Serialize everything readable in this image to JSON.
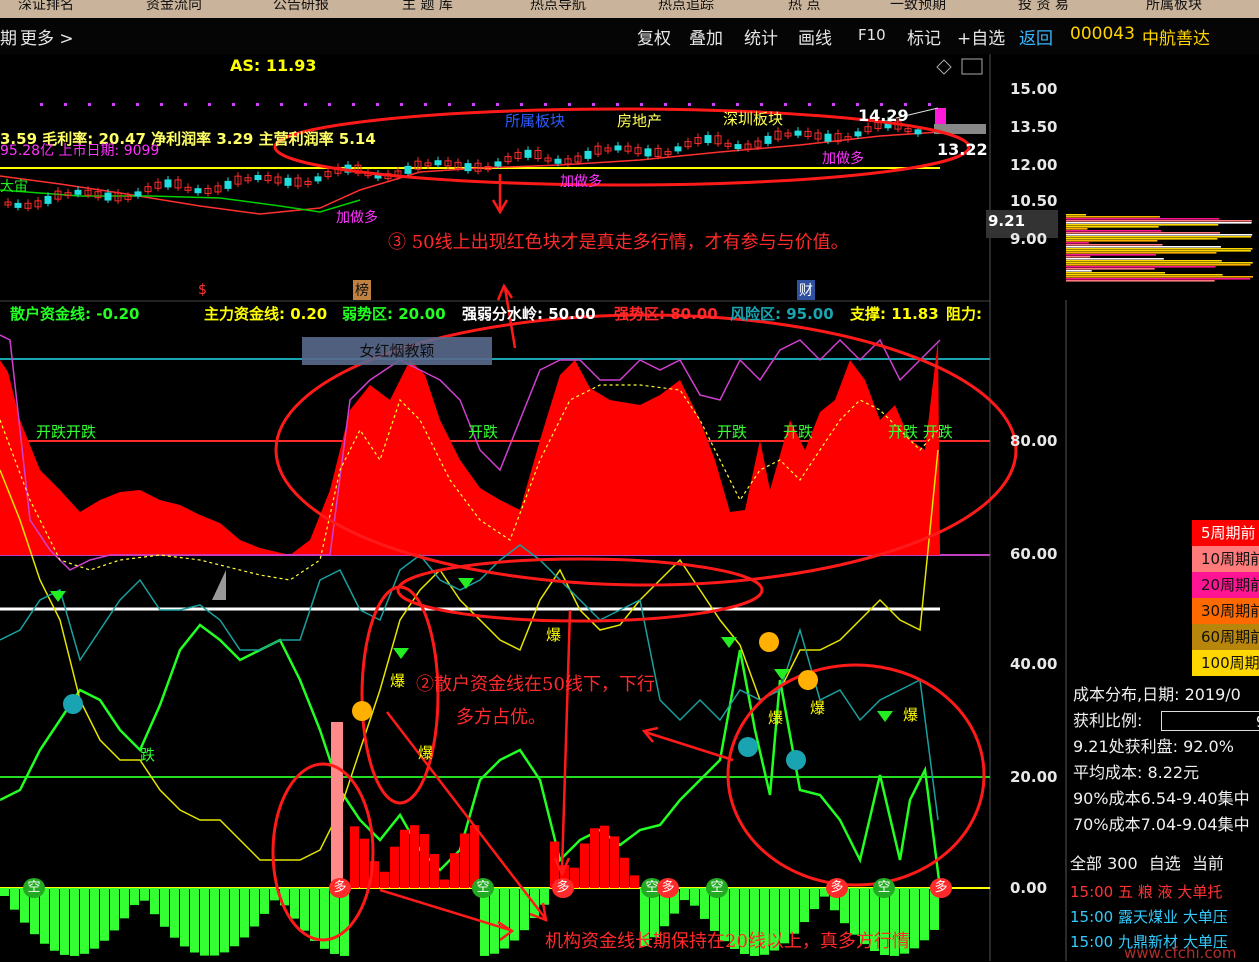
{
  "topnav": [
    "深证排名",
    "资金流向",
    "公告研报",
    "主 题 库",
    "热点导航",
    "热点追踪",
    "热  点",
    "一致预期",
    "投 资 易",
    "所属板块"
  ],
  "toolbar": {
    "left_text": "期",
    "more": "更多 >",
    "buttons": [
      "复权",
      "叠加",
      "统计",
      "画线",
      "F10",
      "标记",
      "+自选"
    ],
    "back": "返回",
    "stock_code": "000043",
    "stock_name": "中航善达"
  },
  "price_panel": {
    "as_label": "AS: 11.93",
    "info_line1": "3.59 毛利率: 20.47 净利润率 3.29 主营利润率 5.14",
    "info_line2": "95.28亿 上市日期: 9099",
    "tag_huge": "大宙",
    "sector1": "所属板块",
    "sector2": "深圳板块",
    "sector3": "房地产",
    "add_more": [
      "加做多",
      "加做多",
      "加做多"
    ],
    "price_high": "14.29",
    "price_last": "13.22",
    "price_low_box": "9.21",
    "y_labels": [
      "15.00",
      "13.50",
      "12.00",
      "10.50",
      "9.00"
    ],
    "markers": [
      "$",
      "榜",
      "财"
    ]
  },
  "indicator_header": {
    "retail_line": "散户资金线: -0.20",
    "main_line": "主力资金线: 0.20",
    "weak_zone": "弱势区: 20.00",
    "strong_line": "强弱分水岭: 50.00",
    "strong_zone": "强势区: 80.00",
    "risk_zone": "风险区: 95.00",
    "support": "支撑: 11.83",
    "resist": "阻力:"
  },
  "indicator_panel": {
    "overlay_label": "女红烟教颖",
    "y_labels": [
      "80.00",
      "60.00",
      "40.00",
      "20.00",
      "0.00"
    ],
    "tags_kai": [
      "开跌开跌",
      "开跌",
      "开跌",
      "开跌",
      "开跌 开跌"
    ],
    "tag_die": "跌",
    "tags_bao": [
      "爆",
      "爆",
      "爆",
      "爆",
      "爆",
      "爆"
    ],
    "tags_kong": [
      "空",
      "空",
      "空",
      "空",
      "空"
    ],
    "tags_duo": [
      "多",
      "多",
      "多",
      "多",
      "多"
    ]
  },
  "annotations": {
    "a3": "③ 50线上出现红色块才是真走多行情，才有参与与价值。",
    "a2_line1": "②散户资金线在50线下，下行",
    "a2_line2": "多方占优。",
    "bottom": "机构资金线长期保持在20线以上，真多方行情"
  },
  "right_panel": {
    "legend": [
      "5周期前",
      "10周期前",
      "20周期前",
      "30周期前",
      "60周期前",
      "100周期前"
    ],
    "legend_colors": [
      "#ff0000",
      "#ff7a7a",
      "#ff1493",
      "#ff6a00",
      "#b8860b",
      "#ffd700"
    ],
    "cost_date": "成本分布,日期: 2019/0",
    "profit_ratio_label": "获利比例:",
    "profit_ratio_value": "9",
    "profit_at": "9.21处获利盘: 92.0%",
    "avg_cost": "平均成本: 8.22元",
    "cost90": "90%成本6.54-9.40集中",
    "cost70": "70%成本7.04-9.04集中",
    "tabs": [
      "全部 300",
      "自选",
      "当前"
    ],
    "ticker": [
      {
        "time": "15:00",
        "name": "五 粮 液",
        "type": "大单托"
      },
      {
        "time": "15:00",
        "name": "露天煤业",
        "type": "大单压"
      },
      {
        "time": "15:00",
        "name": "九鼎新材",
        "type": "大单压"
      }
    ]
  },
  "watermark": "www.cfchi.com"
}
